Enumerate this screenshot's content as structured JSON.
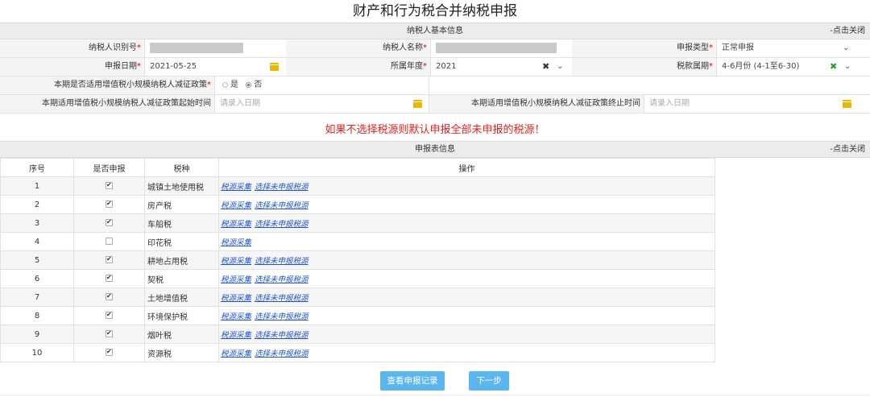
{
  "page": {
    "title": "财产和行为税合并纳税申报",
    "warning": "如果不选择税源则默认申报全部未申报的税源！"
  },
  "basic_info": {
    "section_title": "纳税人基本信息",
    "collapse": "-点击关闭",
    "taxpayer_id_label": "纳税人识别号",
    "taxpayer_name_label": "纳税人名称",
    "decl_type_label": "申报类型",
    "decl_type_value": "正常申报",
    "decl_date_label": "申报日期",
    "decl_date_value": "2021-05-25",
    "year_label": "所属年度",
    "year_value": "2021",
    "period_label": "税款属期",
    "period_value": "4-6月份 (4-1至6-30)",
    "policy_label": "本期是否适用增值税小规模纳税人减征政策",
    "policy_yes": "是",
    "policy_no": "否",
    "policy_selected": "否",
    "start_label": "本期适用增值税小规模纳税人减征政策起始时间",
    "start_placeholder": "请录入日期",
    "end_label": "本期适用增值税小规模纳税人减征政策终止时间",
    "end_placeholder": "请录入日期"
  },
  "decl_table": {
    "section_title": "申报表信息",
    "collapse": "-点击关闭",
    "headers": [
      "序号",
      "是否申报",
      "税种",
      "操作"
    ],
    "link_collect": "税源采集",
    "link_select": "选择未申报税源",
    "rows": [
      {
        "idx": "1",
        "checked": true,
        "tax": "城镇土地使用税",
        "select_link": true
      },
      {
        "idx": "2",
        "checked": true,
        "tax": "房产税",
        "select_link": true
      },
      {
        "idx": "3",
        "checked": true,
        "tax": "车船税",
        "select_link": true
      },
      {
        "idx": "4",
        "checked": false,
        "tax": "印花税",
        "select_link": false
      },
      {
        "idx": "5",
        "checked": true,
        "tax": "耕地占用税",
        "select_link": true
      },
      {
        "idx": "6",
        "checked": true,
        "tax": "契税",
        "select_link": true
      },
      {
        "idx": "7",
        "checked": true,
        "tax": "土地增值税",
        "select_link": true
      },
      {
        "idx": "8",
        "checked": true,
        "tax": "环境保护税",
        "select_link": true
      },
      {
        "idx": "9",
        "checked": true,
        "tax": "烟叶税",
        "select_link": true
      },
      {
        "idx": "10",
        "checked": true,
        "tax": "资源税",
        "select_link": true
      }
    ]
  },
  "buttons": {
    "history": "查看申报记录",
    "next": "下一步"
  },
  "colors": {
    "required": "#e00000",
    "warning": "#e02020",
    "link": "#2255cc",
    "button": "#5bb6f0",
    "calendar": "#e8b800"
  }
}
